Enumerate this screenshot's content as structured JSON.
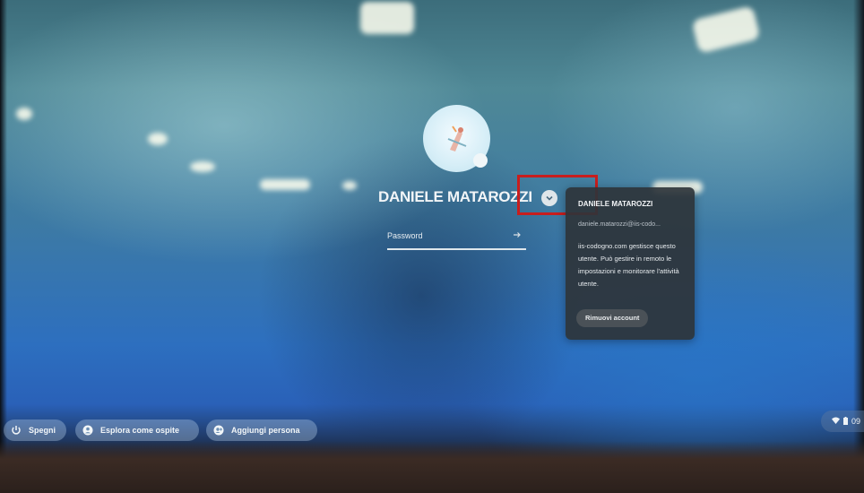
{
  "login": {
    "user_name": "DANIELE MATAROZZI",
    "password_placeholder": "Password"
  },
  "account_popup": {
    "name": "DANIELE MATAROZZI",
    "email": "daniele.matarozzi@iis-codo...",
    "message": "iis-codogno.com gestisce questo utente. Può gestire in remoto le impostazioni e monitorare l'attività utente.",
    "remove_button": "Rimuovi account"
  },
  "shelf": {
    "shutdown": "Spegni",
    "browse_as_guest": "Esplora come ospite",
    "add_person": "Aggiungi persona"
  },
  "status": {
    "time": "09"
  },
  "icons": {
    "power": "power-icon",
    "guest": "person-icon",
    "add_person": "add-person-icon",
    "chevron": "chevron-down-icon",
    "submit": "arrow-right-icon",
    "wifi": "wifi-icon",
    "battery": "battery-icon"
  },
  "highlight_color": "#c81e1e"
}
